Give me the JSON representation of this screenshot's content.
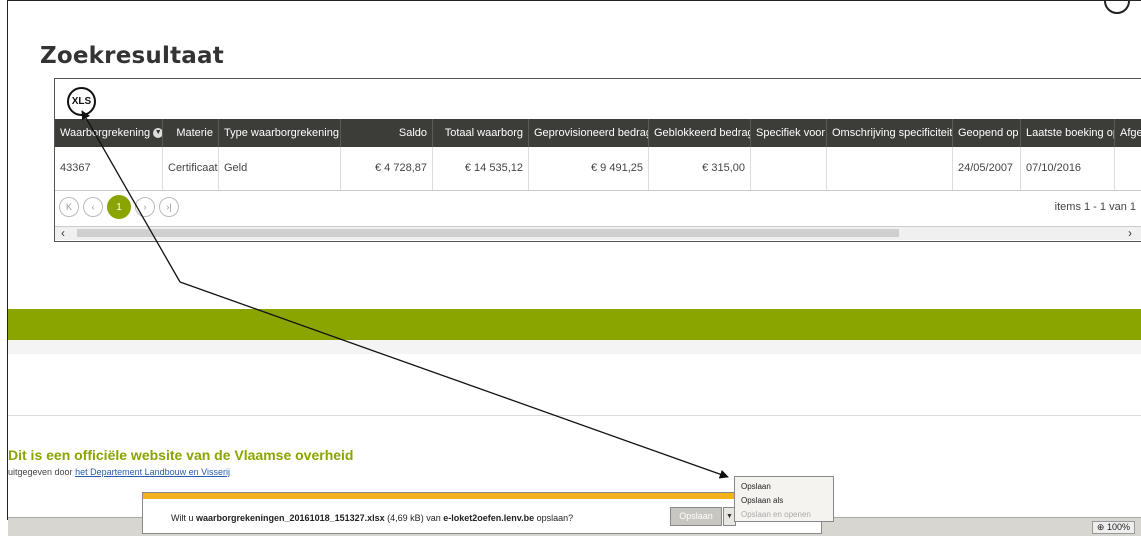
{
  "page": {
    "title": "Zoekresultaat"
  },
  "grid": {
    "export_label": "XLS",
    "columns": [
      {
        "label": "Waarborgrekening"
      },
      {
        "label": "Materie"
      },
      {
        "label": "Type waarborgrekening"
      },
      {
        "label": "Saldo"
      },
      {
        "label": "Totaal waarborg"
      },
      {
        "label": "Geprovisioneerd bedrag"
      },
      {
        "label": "Geblokkeerd bedrag"
      },
      {
        "label": "Specifiek voor"
      },
      {
        "label": "Omschrijving specificiteit"
      },
      {
        "label": "Geopend op"
      },
      {
        "label": "Laatste boeking op"
      },
      {
        "label": "Afge"
      }
    ],
    "rows": [
      [
        "43367",
        "Certificaat",
        "Geld",
        "€ 4 728,87",
        "€ 14 535,12",
        "€ 9 491,25",
        "€ 315,00",
        "",
        "",
        "24/05/2007",
        "07/10/2016",
        ""
      ]
    ],
    "pager": {
      "first": "K",
      "prev": "‹",
      "page": "1",
      "next": "›",
      "last": "›|",
      "info": "items 1 - 1 van 1"
    }
  },
  "footer": {
    "official": "Dit is een officiële website van de Vlaamse overheid",
    "publisher_prefix": "uitgegeven door",
    "publisher_link": "het Departement Landbouw en Visserij"
  },
  "download_bar": {
    "q_prefix": "Wilt u",
    "filename": "waarborgrekeningen_20161018_151327.xlsx",
    "size": "(4,69 kB)",
    "van": "van",
    "host": "e-loket2oefen.lenv.be",
    "q_suffix": "opslaan?",
    "save_label": "Opslaan",
    "menu": [
      "Opslaan",
      "Opslaan als",
      "Opslaan en openen"
    ]
  },
  "statusbar": {
    "zoom": "100%"
  },
  "colors": {
    "accent": "#8aa400",
    "header_bg": "#3c3c38",
    "notif_bar": "#f2b21d"
  }
}
